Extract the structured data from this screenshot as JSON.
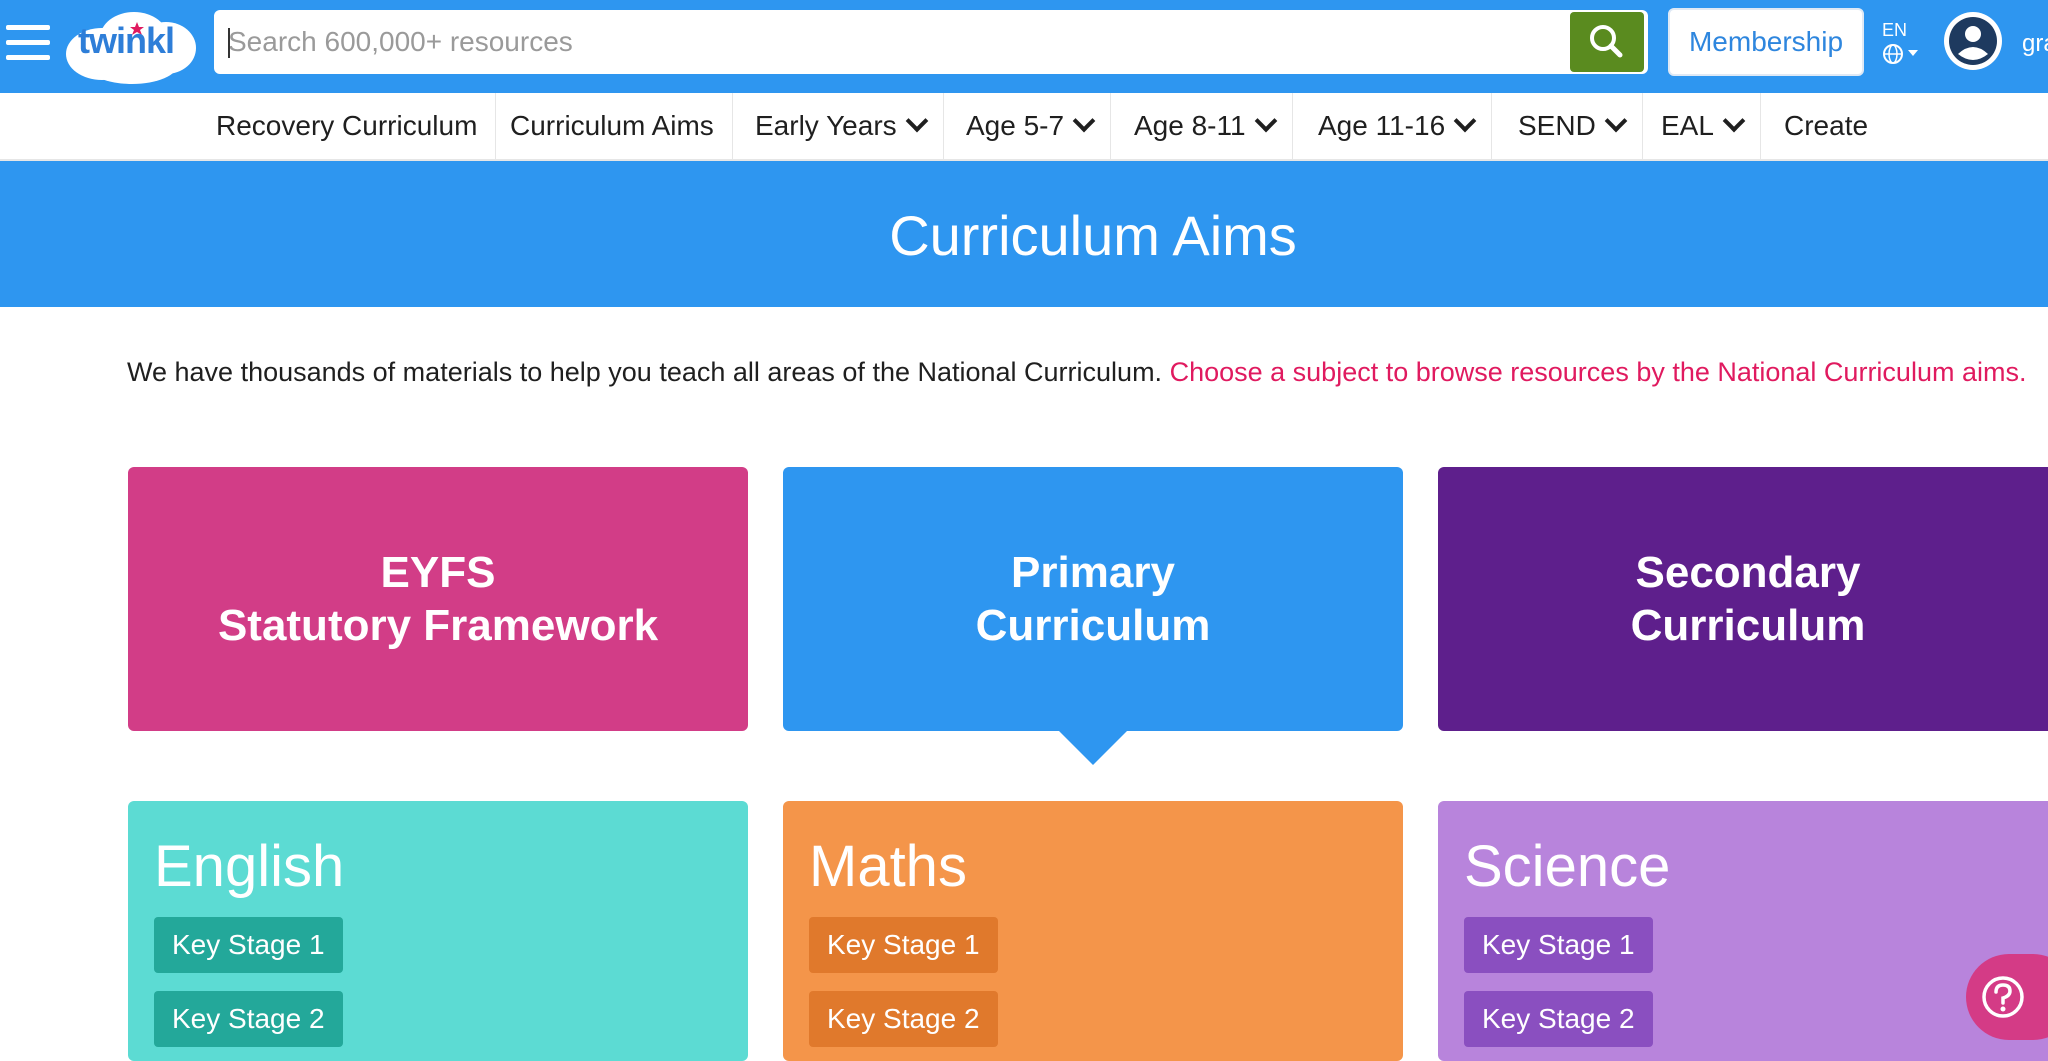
{
  "header": {
    "logo_text": "twinkl",
    "search": {
      "placeholder": "Search 600,000+ resources",
      "value": ""
    },
    "membership_label": "Membership",
    "language_code": "EN",
    "user_name": "gra"
  },
  "nav": {
    "items": [
      {
        "label": "Recovery Curriculum",
        "dropdown": false
      },
      {
        "label": "Curriculum Aims",
        "dropdown": false
      },
      {
        "label": "Early Years",
        "dropdown": true
      },
      {
        "label": "Age 5-7",
        "dropdown": true
      },
      {
        "label": "Age 8-11",
        "dropdown": true
      },
      {
        "label": "Age 11-16",
        "dropdown": true
      },
      {
        "label": "SEND",
        "dropdown": true
      },
      {
        "label": "EAL",
        "dropdown": true
      },
      {
        "label": "Create",
        "dropdown": false
      }
    ]
  },
  "banner": {
    "title": "Curriculum Aims"
  },
  "intro": {
    "text": "We have thousands of materials to help you teach all areas of the National Curriculum.",
    "highlight": "Choose a subject to browse resources by the National Curriculum aims."
  },
  "curricula": [
    {
      "line1": "EYFS",
      "line2": "Statutory Framework",
      "color": "#d23d87"
    },
    {
      "line1": "Primary",
      "line2": "Curriculum",
      "color": "#2e96f0",
      "selected": true
    },
    {
      "line1": "Secondary",
      "line2": "Curriculum",
      "color": "#5e1f8c"
    }
  ],
  "subjects": [
    {
      "title": "English",
      "color": "#5cdbd3",
      "stages": [
        "Key Stage 1",
        "Key Stage 2"
      ]
    },
    {
      "title": "Maths",
      "color": "#f4954a",
      "stages": [
        "Key Stage 1",
        "Key Stage 2"
      ]
    },
    {
      "title": "Science",
      "color": "#b884dc",
      "stages": [
        "Key Stage 1",
        "Key Stage 2"
      ]
    }
  ],
  "colors": {
    "brand_blue": "#2e96f0",
    "search_green": "#5a8b1f",
    "highlight_pink": "#e01a5f"
  }
}
